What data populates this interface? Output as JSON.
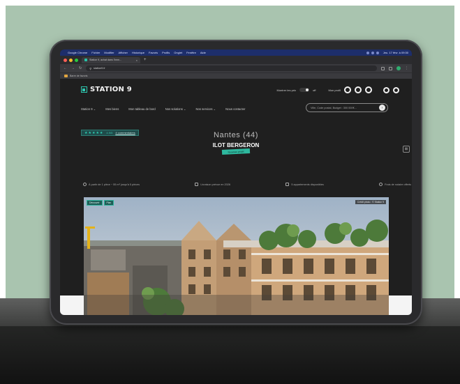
{
  "browser": {
    "menubar_items": [
      "Google Chrome",
      "Fichier",
      "Modifier",
      "Afficher",
      "Historique",
      "Favoris",
      "Profils",
      "Onglet",
      "Fenêtre",
      "Aide"
    ],
    "menubar_clock": "Jeu. 17 févr. à 09:30",
    "tab_title": "Station 9, achat dans l'imm...",
    "url": "station9.fr",
    "bookmark": "Barre de favoris"
  },
  "site": {
    "logo": "STATION 9",
    "toggle_label": "Montrer les prix",
    "toggle_state": "off",
    "mon_profil": "Mon profil",
    "menu": [
      "Station 9 ⌄",
      "Mes biens",
      "Mon tableau de bord",
      "Nos solutions ⌄",
      "Nos services ⌄",
      "Nous contacter"
    ],
    "search_placeholder": "Ville, Code postal, Budget : 300 000€...",
    "rating": {
      "stars": "★★★★★",
      "score": "4.9/5",
      "reviews": "4 commentaires"
    },
    "city": "Nantes (44)",
    "project": "ILOT BERGERON",
    "badge": "Nouveau projet",
    "info": [
      "À partir de 1 pièce ~ 55 m² jusqu'à 5 pièces",
      "Livraison prévue en 2026",
      "5 appartements disponibles",
      "Frais de notaire offerts"
    ],
    "hero": {
      "tags": [
        "Découvrir",
        "Plan"
      ],
      "credit": "Crédit photo : © Station 9"
    }
  }
}
